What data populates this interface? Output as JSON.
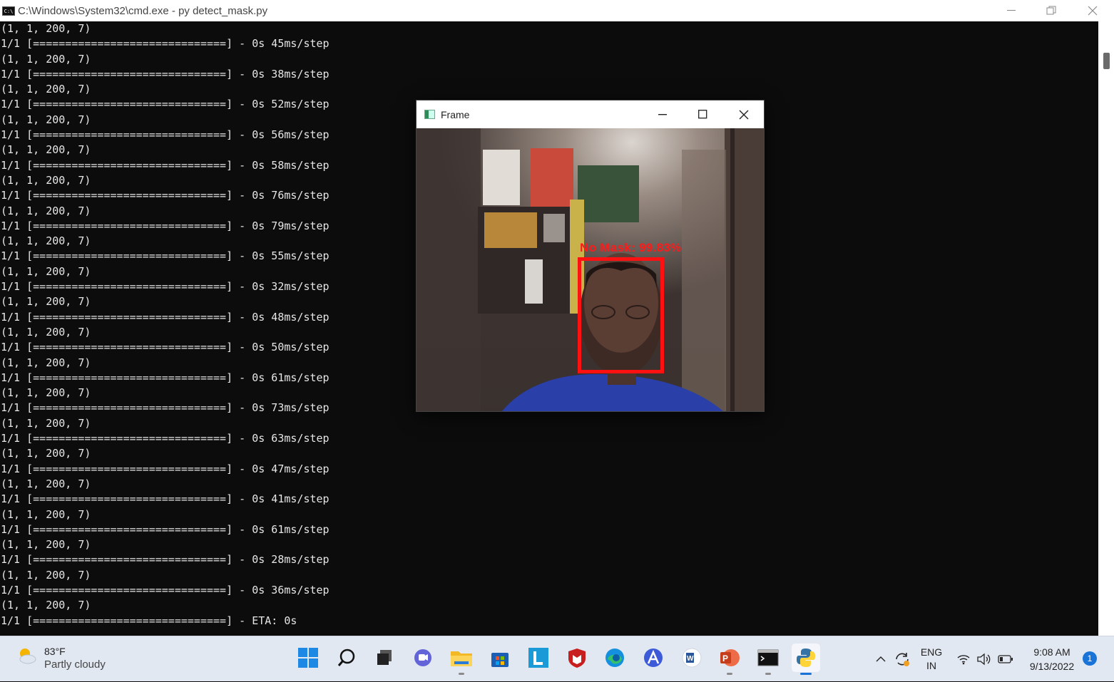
{
  "window": {
    "title": "C:\\Windows\\System32\\cmd.exe - py  detect_mask.py"
  },
  "console": {
    "lines": [
      "(1, 1, 200, 7)",
      "1/1 [==============================] - 0s 45ms/step",
      "(1, 1, 200, 7)",
      "1/1 [==============================] - 0s 38ms/step",
      "(1, 1, 200, 7)",
      "1/1 [==============================] - 0s 52ms/step",
      "(1, 1, 200, 7)",
      "1/1 [==============================] - 0s 56ms/step",
      "(1, 1, 200, 7)",
      "1/1 [==============================] - 0s 58ms/step",
      "(1, 1, 200, 7)",
      "1/1 [==============================] - 0s 76ms/step",
      "(1, 1, 200, 7)",
      "1/1 [==============================] - 0s 79ms/step",
      "(1, 1, 200, 7)",
      "1/1 [==============================] - 0s 55ms/step",
      "(1, 1, 200, 7)",
      "1/1 [==============================] - 0s 32ms/step",
      "(1, 1, 200, 7)",
      "1/1 [==============================] - 0s 48ms/step",
      "(1, 1, 200, 7)",
      "1/1 [==============================] - 0s 50ms/step",
      "(1, 1, 200, 7)",
      "1/1 [==============================] - 0s 61ms/step",
      "(1, 1, 200, 7)",
      "1/1 [==============================] - 0s 73ms/step",
      "(1, 1, 200, 7)",
      "1/1 [==============================] - 0s 63ms/step",
      "(1, 1, 200, 7)",
      "1/1 [==============================] - 0s 47ms/step",
      "(1, 1, 200, 7)",
      "1/1 [==============================] - 0s 41ms/step",
      "(1, 1, 200, 7)",
      "1/1 [==============================] - 0s 61ms/step",
      "(1, 1, 200, 7)",
      "1/1 [==============================] - 0s 28ms/step",
      "(1, 1, 200, 7)",
      "1/1 [==============================] - 0s 36ms/step",
      "(1, 1, 200, 7)",
      "1/1 [==============================] - ETA: 0s"
    ]
  },
  "frame_window": {
    "title": "Frame",
    "detection_label": "No Mask: 99.83%",
    "detection_color": "#ff1111"
  },
  "taskbar": {
    "weather": {
      "temp": "83°F",
      "condition": "Partly cloudy"
    },
    "language": {
      "line1": "ENG",
      "line2": "IN"
    },
    "clock": {
      "time": "9:08 AM",
      "date": "9/13/2022"
    },
    "notification_count": "1",
    "apps": [
      "start",
      "search",
      "task-view",
      "teams-chat",
      "file-explorer",
      "microsoft-store",
      "l-app",
      "mcafee",
      "edge",
      "arc-app",
      "word-app",
      "powerpoint",
      "terminal",
      "python"
    ]
  }
}
